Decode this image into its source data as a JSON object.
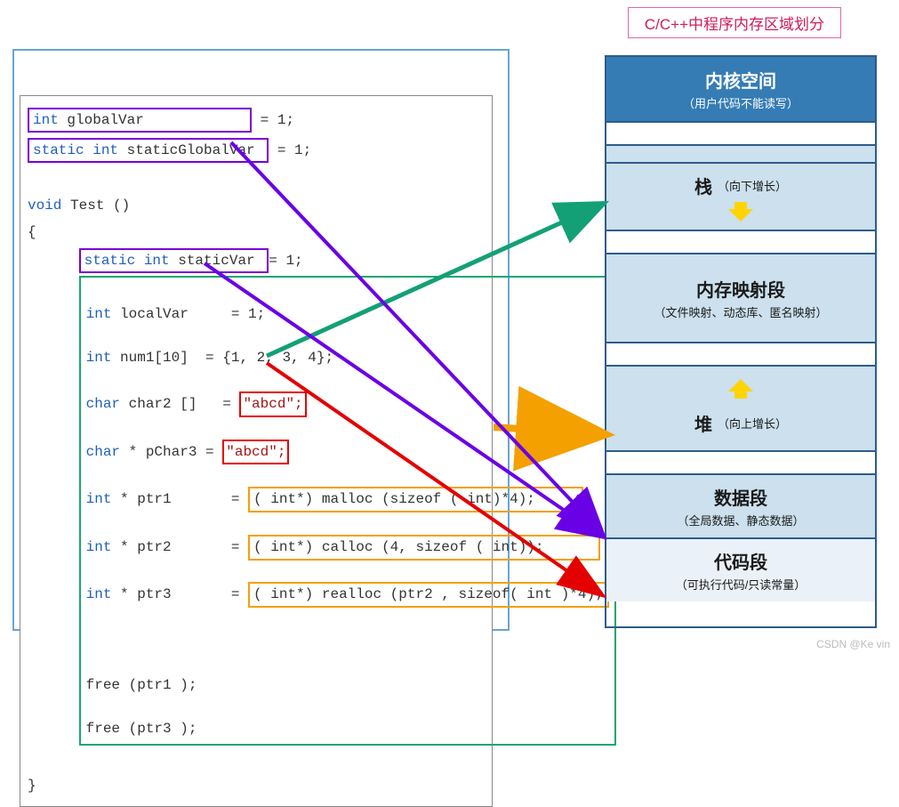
{
  "title": "C/C++中程序内存区域划分",
  "code": {
    "l1a": "int",
    "l1b": " globalVar            ",
    "l1c": " = 1;",
    "l2a": "static int",
    "l2b": " staticGlobalVar ",
    "l2c": " = 1;",
    "l3": "void",
    "l3b": " Test ()",
    "l4": "{",
    "l5a": "static int",
    "l5b": " staticVar ",
    "l5c": "= 1;",
    "l6a": "int",
    "l6b": " localVar     = 1;",
    "l7a": "int",
    "l7b": " num1[10]  = {1, 2, 3, 4};",
    "l8a": "char",
    "l8b": " char2 []   = ",
    "l8c": "\"abcd\";",
    "l9a": "char",
    "l9b": " * pChar3 = ",
    "l9c": "\"abcd\";",
    "l10a": "int",
    "l10b": " * ptr1       = ",
    "l10c": "( int*) malloc (sizeof ( int)*4);",
    "l11a": "int",
    "l11b": " * ptr2       = ",
    "l11c": "( int*) calloc (4, sizeof ( int));",
    "l12a": "int",
    "l12b": " * ptr3       = ",
    "l12c": "( int*) realloc (ptr2 , sizeof( int )*4);",
    "l13": "free (ptr1 );",
    "l14": "free (ptr3 );",
    "l15": "}"
  },
  "memory": {
    "kernel_title": "内核空间",
    "kernel_sub": "（用户代码不能读写）",
    "stack_title": "栈",
    "stack_sub": "（向下增长）",
    "mmap_title": "内存映射段",
    "mmap_sub": "（文件映射、动态库、匿名映射）",
    "heap_title": "堆",
    "heap_sub": "（向上增长）",
    "data_title": "数据段",
    "data_sub": "（全局数据、静态数据）",
    "code_title": "代码段",
    "code_sub": "（可执行代码/只读常量）"
  },
  "watermark": "CSDN @Ke vin"
}
